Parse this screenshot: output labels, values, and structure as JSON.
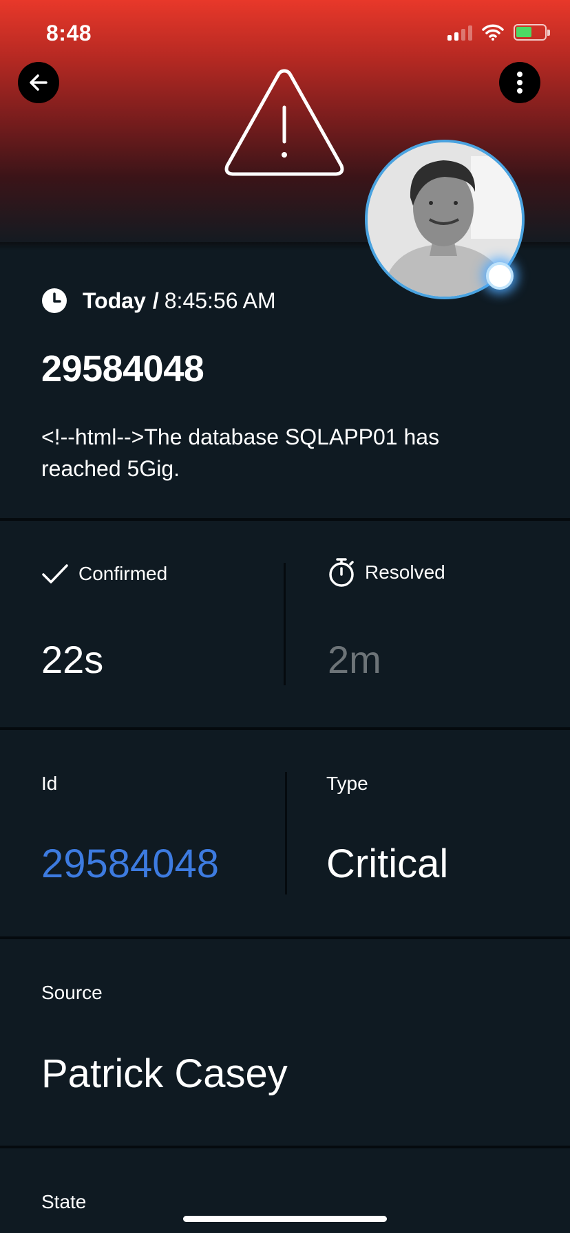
{
  "status_bar": {
    "time": "8:48"
  },
  "header": {
    "back_icon": "arrow-left-icon",
    "menu_icon": "more-vertical-icon",
    "alert_icon": "warning-triangle-icon",
    "gradient_top": "#e8382a",
    "gradient_bottom": "#121b22"
  },
  "avatar": {
    "presence_color": "#4aa3e0"
  },
  "summary": {
    "day": "Today",
    "separator": "/",
    "time": "8:45:56 AM",
    "alert_number": "29584048",
    "message": "<!--html-->The database SQLAPP01 has reached 5Gig."
  },
  "timings": {
    "confirmed": {
      "label": "Confirmed",
      "value": "22s",
      "icon": "checkmark-icon"
    },
    "resolved": {
      "label": "Resolved",
      "value": "2m",
      "icon": "stopwatch-icon"
    }
  },
  "details": {
    "id": {
      "label": "Id",
      "value": "29584048",
      "link_color": "#3d7be0"
    },
    "type": {
      "label": "Type",
      "value": "Critical"
    },
    "source": {
      "label": "Source",
      "value": "Patrick Casey"
    },
    "state": {
      "label": "State"
    }
  },
  "colors": {
    "background": "#0f1a22",
    "divider": "#050a0e",
    "muted": "#6d7478"
  }
}
